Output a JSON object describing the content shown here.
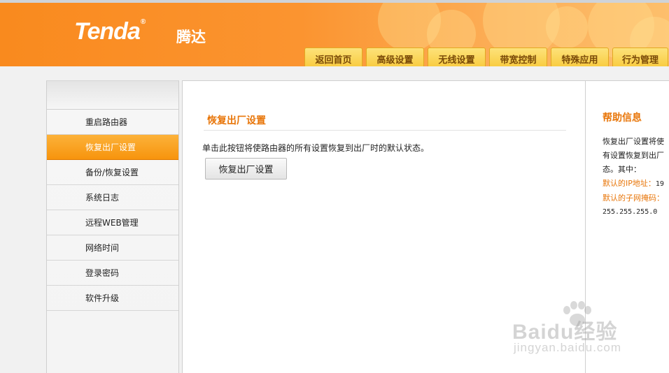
{
  "brand": {
    "logo": "Tenda",
    "logo_mark": "®",
    "logo_cn": "腾达"
  },
  "nav": {
    "tabs": [
      "返回首页",
      "高级设置",
      "无线设置",
      "带宽控制",
      "特殊应用",
      "行为管理"
    ]
  },
  "sidebar": {
    "items": [
      "重启路由器",
      "恢复出厂设置",
      "备份/恢复设置",
      "系统日志",
      "远程WEB管理",
      "网络时间",
      "登录密码",
      "软件升级"
    ],
    "active_index": 1
  },
  "main": {
    "title": "恢复出厂设置",
    "description": "单击此按钮将使路由器的所有设置恢复到出厂时的默认状态。",
    "button_label": "恢复出厂设置"
  },
  "help": {
    "title": "帮助信息",
    "line1": "恢复出厂设置将使",
    "line2": "有设置恢复到出厂",
    "line3": "态。其中：",
    "ip_label": "默认的IP地址：",
    "ip_value": "19",
    "mask_label": "默认的子网掩码：",
    "mask_value": "255.255.255.0"
  },
  "watermark": {
    "text": "Baidu经验",
    "sub": "jingyan.baidu.com"
  },
  "colors": {
    "accent": "#e8760a",
    "header": "#f98a1e",
    "tab": "#f8c93a",
    "active_item": "#f7940d"
  }
}
